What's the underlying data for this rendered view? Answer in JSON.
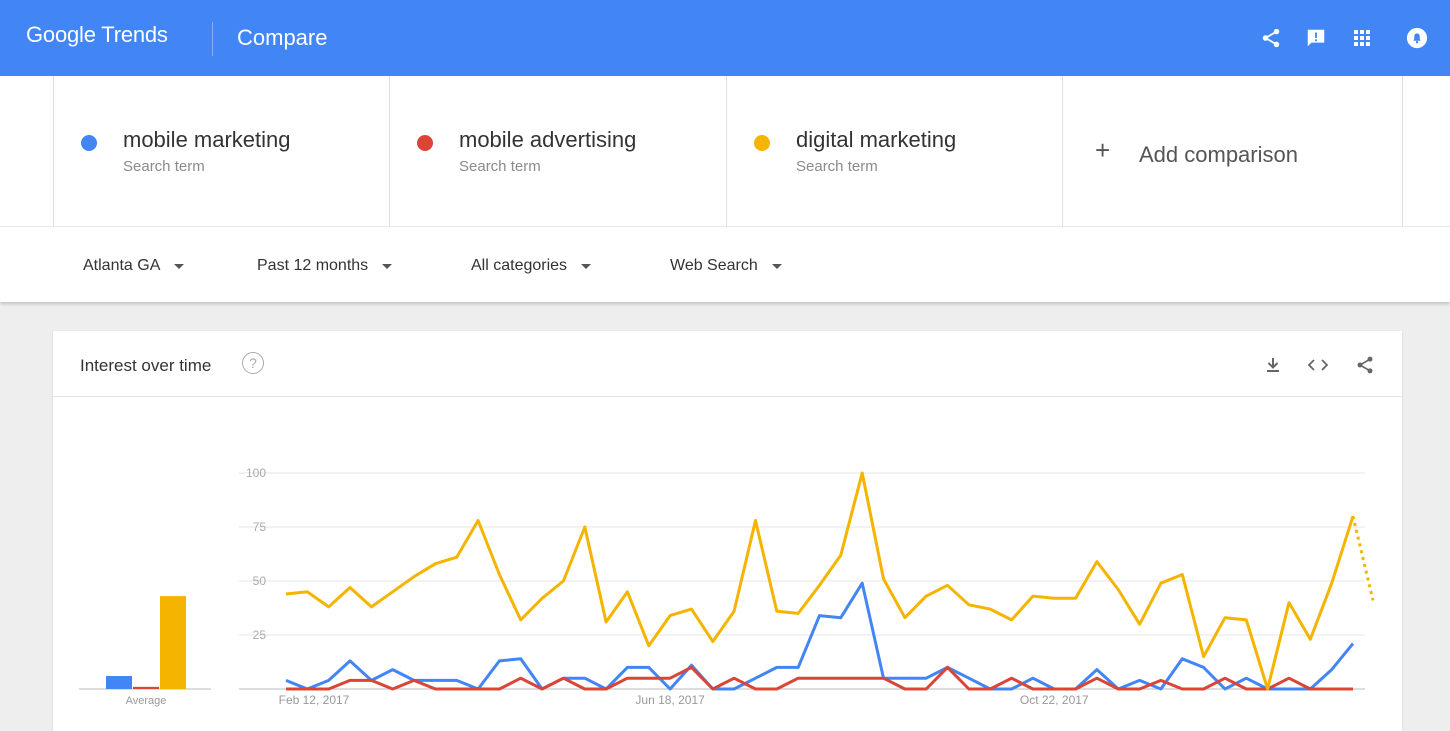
{
  "header": {
    "brand_google": "Google",
    "brand_trends": "Trends",
    "page_title": "Compare",
    "icons": [
      "share-icon",
      "feedback-icon",
      "apps-grid-icon",
      "notifications-icon"
    ]
  },
  "terms": [
    {
      "name": "mobile marketing",
      "sub": "Search term",
      "color": "#4285f4"
    },
    {
      "name": "mobile advertising",
      "sub": "Search term",
      "color": "#db4437"
    },
    {
      "name": "digital marketing",
      "sub": "Search term",
      "color": "#f4b400"
    }
  ],
  "add_comparison": {
    "plus": "+",
    "label": "Add comparison"
  },
  "filters": {
    "region": "Atlanta GA",
    "time": "Past 12 months",
    "category": "All categories",
    "property": "Web Search"
  },
  "card": {
    "title": "Interest over time",
    "help": "?",
    "icons": [
      "download-icon",
      "embed-icon",
      "share-icon"
    ]
  },
  "chart_data": {
    "type": "line",
    "ylim": [
      0,
      100
    ],
    "yticks": [
      25,
      50,
      75,
      100
    ],
    "x_tick_labels": [
      {
        "label": "Feb 12, 2017",
        "index": 0
      },
      {
        "label": "Jun 18, 2017",
        "index": 18
      },
      {
        "label": "Oct 22, 2017",
        "index": 36
      }
    ],
    "average": {
      "label": "Average",
      "values": [
        6,
        1,
        43
      ]
    },
    "series": [
      {
        "term": "mobile marketing",
        "color": "#4285f4",
        "values": [
          4,
          0,
          4,
          13,
          4,
          9,
          4,
          4,
          4,
          0,
          13,
          14,
          0,
          5,
          5,
          0,
          10,
          10,
          0,
          11,
          0,
          0,
          5,
          10,
          10,
          34,
          33,
          49,
          5,
          5,
          5,
          10,
          5,
          0,
          0,
          5,
          0,
          0,
          9,
          0,
          4,
          0,
          14,
          10,
          0,
          5,
          0,
          0,
          0,
          9,
          21
        ]
      },
      {
        "term": "mobile advertising",
        "color": "#db4437",
        "values": [
          0,
          0,
          0,
          4,
          4,
          0,
          4,
          0,
          0,
          0,
          0,
          5,
          0,
          5,
          0,
          0,
          5,
          5,
          5,
          10,
          0,
          5,
          0,
          0,
          5,
          5,
          5,
          5,
          5,
          0,
          0,
          10,
          0,
          0,
          5,
          0,
          0,
          0,
          5,
          0,
          0,
          4,
          0,
          0,
          5,
          0,
          0,
          5,
          0,
          0,
          0
        ]
      },
      {
        "term": "digital marketing",
        "color": "#f4b400",
        "values": [
          44,
          45,
          38,
          47,
          38,
          45,
          52,
          58,
          61,
          78,
          53,
          32,
          42,
          50,
          75,
          31,
          45,
          20,
          34,
          37,
          22,
          36,
          78,
          36,
          35,
          48,
          62,
          100,
          51,
          33,
          43,
          48,
          39,
          37,
          32,
          43,
          42,
          42,
          59,
          46,
          30,
          49,
          53,
          15,
          33,
          32,
          0,
          40,
          23,
          49,
          80,
          41
        ],
        "partial_last": true
      }
    ]
  }
}
